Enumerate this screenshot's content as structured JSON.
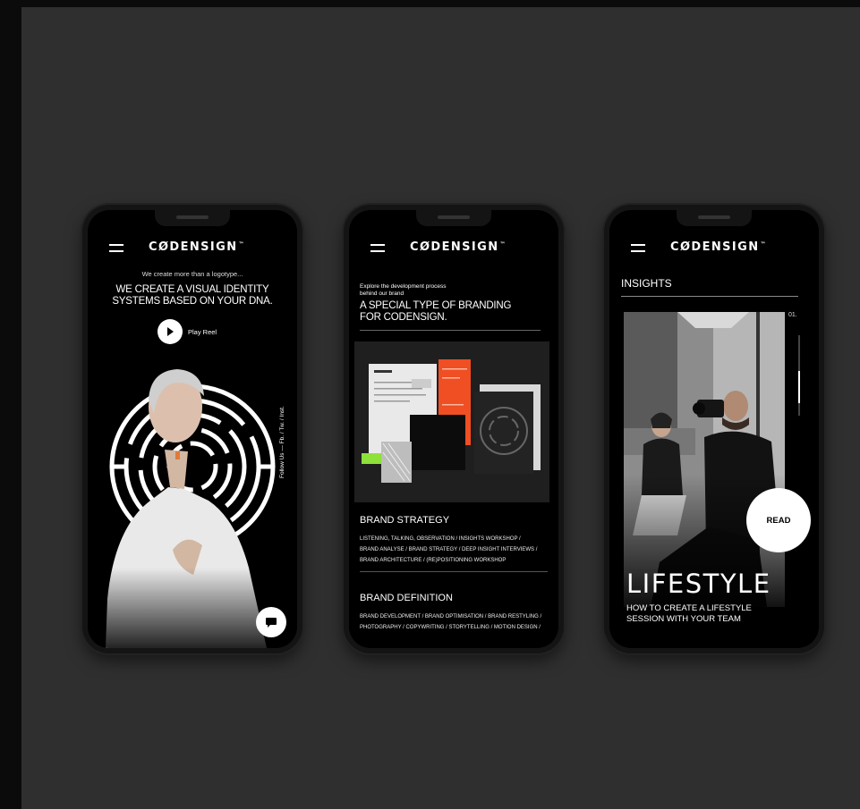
{
  "brand": {
    "name": "CØDENSIGN",
    "tm": "™"
  },
  "phone1": {
    "eyebrow": "We create more than a logotype...",
    "title_line1": "WE CREATE A VISUAL IDENTITY",
    "title_line2": "SYSTEMS BASED ON YOUR DNA.",
    "play_label": "Play Reel",
    "follow_text": "Follow Us — Fb. / Tw. / Inst."
  },
  "phone2": {
    "eyebrow_line1": "Explore the development process",
    "eyebrow_line2": "behind our brand",
    "title_line1": "A SPECIAL TYPE OF BRANDING",
    "title_line2": "FOR CODENSIGN.",
    "sections": [
      {
        "title": "BRAND STRATEGY",
        "lines": [
          "LISTENING, TALKING, OBSERVATION / INSIGHTS WORKSHOP /",
          "BRAND ANALYSE / BRAND STRATEGY / DEEP INSIGHT INTERVIEWS /",
          "BRAND ARCHITECTURE / (RE)POSITIONING WORKSHOP"
        ]
      },
      {
        "title": "BRAND DEFINITION",
        "lines": [
          "BRAND DEVELOPMENT / BRAND OPTIMISATION / BRAND RESTYLING /",
          "PHOTOGRAPHY / COPYWRITING / STORYTELLING / MOTION DESIGN /"
        ]
      }
    ]
  },
  "phone3": {
    "section_title": "INSIGHTS",
    "index": "01.",
    "category": "LIFESTYLE",
    "article_line1": "HOW TO CREATE A LIFESTYLE",
    "article_line2": "SESSION WITH YOUR TEAM",
    "read_label": "READ"
  },
  "colors": {
    "background": "#2f2f2f",
    "accent": "#f04e23",
    "highlight": "#8ee03a"
  }
}
